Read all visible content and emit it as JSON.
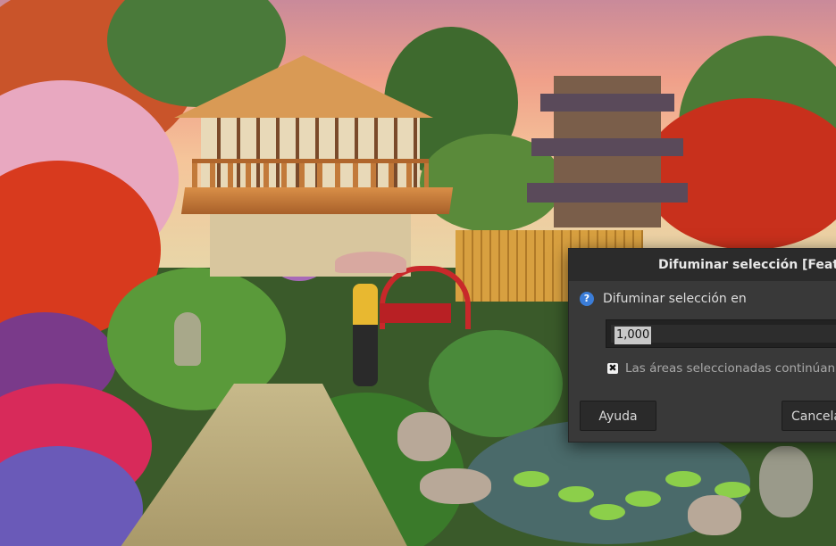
{
  "dialog": {
    "title": "Difuminar selección [Feather]",
    "prompt": "Difuminar selección en",
    "value": "1,000",
    "checkbox_label": "Las áreas seleccionadas continúan fu",
    "checkbox_checked": true,
    "help_button": "Ayuda",
    "cancel_button": "Cancela"
  },
  "icons": {
    "prompt_icon": "help-icon",
    "checkbox_mark": "✖"
  },
  "colors": {
    "dialog_bg": "#393939",
    "titlebar_bg": "#2b2b2b",
    "info_icon": "#3b7dd8"
  }
}
